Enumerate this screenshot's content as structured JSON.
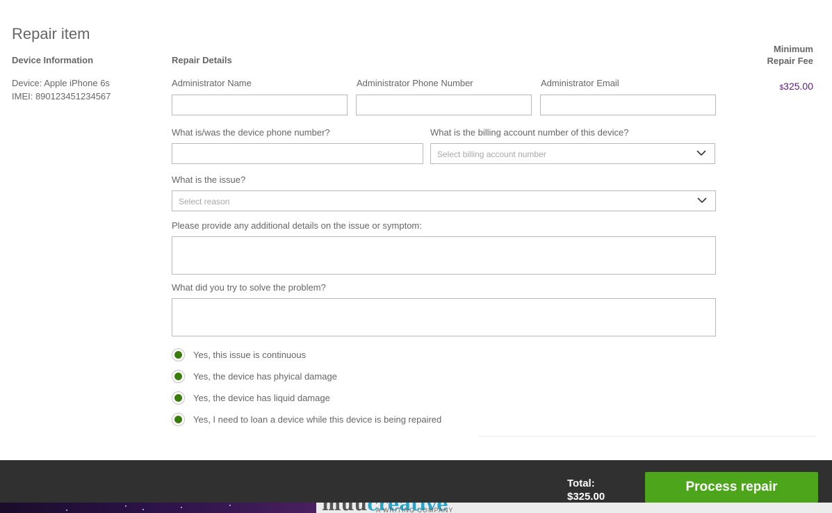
{
  "page": {
    "title": "Repair item"
  },
  "device_info": {
    "heading": "Device Information",
    "device": "Device: Apple iPhone 6s",
    "imei": "IMEI: 890123451234567"
  },
  "repair_details": {
    "heading": "Repair Details",
    "admin_name_label": "Administrator Name",
    "admin_name_value": "",
    "admin_phone_label": "Administrator Phone Number",
    "admin_phone_value": "",
    "admin_email_label": "Administrator Email",
    "admin_email_value": "",
    "device_phone_label": "What is/was the device phone number?",
    "device_phone_value": "",
    "billing_label": "What is the billing account number of this device?",
    "billing_placeholder": "Select billing account number",
    "issue_label": "What is the issue?",
    "issue_placeholder": "Select reason",
    "details_label": "Please provide any additional details on the issue or symptom:",
    "details_value": "",
    "tried_label": "What did you try to solve the problem?",
    "tried_value": "",
    "options": [
      {
        "label": "Yes, this issue is continuous",
        "selected": true
      },
      {
        "label": "Yes, the device has phyical damage",
        "selected": true
      },
      {
        "label": "Yes, the device has liquid damage",
        "selected": true
      },
      {
        "label": "Yes, I need to loan a device while this device is being repaired",
        "selected": true
      }
    ]
  },
  "fee": {
    "heading_line1": "Minimum",
    "heading_line2": "Repair Fee",
    "currency": "$",
    "amount": "325.00",
    "color": "#5a1a7a"
  },
  "footer": {
    "total_label": "Total:",
    "total_value": "$325.00",
    "process_button": "Process repair",
    "button_color": "#4ca51a"
  },
  "ad": {
    "logo_text_a": "muu",
    "logo_text_b": "creative",
    "tagline": "A WRITING COMPANY"
  },
  "icons": {
    "select_chevron": "chevron-down-icon"
  }
}
